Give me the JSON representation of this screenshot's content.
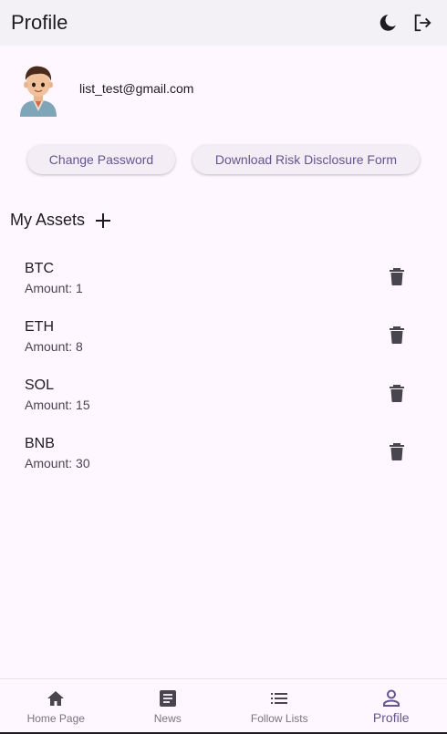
{
  "appbar": {
    "title": "Profile",
    "icons": [
      "moon-icon",
      "logout-icon"
    ]
  },
  "profile": {
    "email": "list_test@gmail.com"
  },
  "buttons": {
    "change_password": "Change Password",
    "download_form": "Download Risk Disclosure Form"
  },
  "assets_section": {
    "title": "My Assets"
  },
  "assets": [
    {
      "symbol": "BTC",
      "amount": "Amount: 1"
    },
    {
      "symbol": "ETH",
      "amount": "Amount: 8"
    },
    {
      "symbol": "SOL",
      "amount": "Amount: 15"
    },
    {
      "symbol": "BNB",
      "amount": "Amount: 30"
    }
  ],
  "nav": [
    {
      "label": "Home Page",
      "icon": "home-icon"
    },
    {
      "label": "News",
      "icon": "article-icon"
    },
    {
      "label": "Follow Lists",
      "icon": "list-icon"
    },
    {
      "label": "Profile",
      "icon": "person-icon",
      "active": true
    }
  ],
  "colors": {
    "accent": "#65558f",
    "background": "#fef7ff",
    "appbar": "#f3f1f6"
  }
}
